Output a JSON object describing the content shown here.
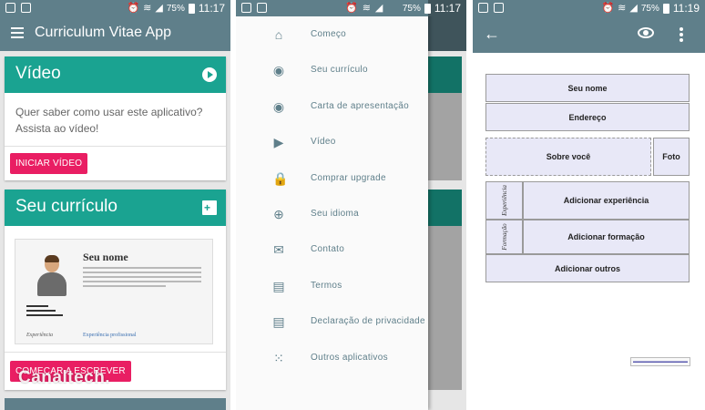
{
  "status_bar": {
    "battery": "75%",
    "time_left": "11:17",
    "time_middle": "11:17",
    "time_right": "11:19"
  },
  "home": {
    "app_title": "Curriculum Vitae App",
    "video_card": {
      "title": "Vídeo",
      "text": "Quer saber como usar este aplicativo? Assista ao vídeo!",
      "button": "INICIAR VÍDEO"
    },
    "resume_card": {
      "title": "Seu currículo",
      "preview_name": "Seu nome",
      "preview_exp_left": "Experiência",
      "preview_exp_right": "Experiência profissional",
      "button": "COMEÇAR A ESCREVER"
    },
    "watermark": "Canaltech."
  },
  "drawer": {
    "items": [
      {
        "icon": "home-icon",
        "glyph": "⌂",
        "label": "Começo"
      },
      {
        "icon": "eye-icon",
        "glyph": "◉",
        "label": "Seu currículo"
      },
      {
        "icon": "eye-icon",
        "glyph": "◉",
        "label": "Carta de apresentação"
      },
      {
        "icon": "play-icon",
        "glyph": "▶",
        "label": "Vídeo"
      },
      {
        "icon": "lock-icon",
        "glyph": "🔒",
        "label": "Comprar upgrade"
      },
      {
        "icon": "globe-icon",
        "glyph": "⊕",
        "label": "Seu idioma"
      },
      {
        "icon": "mail-icon",
        "glyph": "✉",
        "label": "Contato"
      },
      {
        "icon": "document-icon",
        "glyph": "▤",
        "label": "Termos"
      },
      {
        "icon": "document-icon",
        "glyph": "▤",
        "label": "Declaração de privacidade"
      },
      {
        "icon": "apps-grid-icon",
        "glyph": "⁙",
        "label": "Outros aplicativos"
      }
    ]
  },
  "editor": {
    "blocks": {
      "name": "Seu nome",
      "address": "Endereço",
      "about": "Sobre você",
      "photo": "Foto",
      "experience_label": "Experiência",
      "add_experience": "Adicionar experiência",
      "education_label": "Formação",
      "add_education": "Adicionar formação",
      "add_other": "Adicionar outros"
    }
  }
}
